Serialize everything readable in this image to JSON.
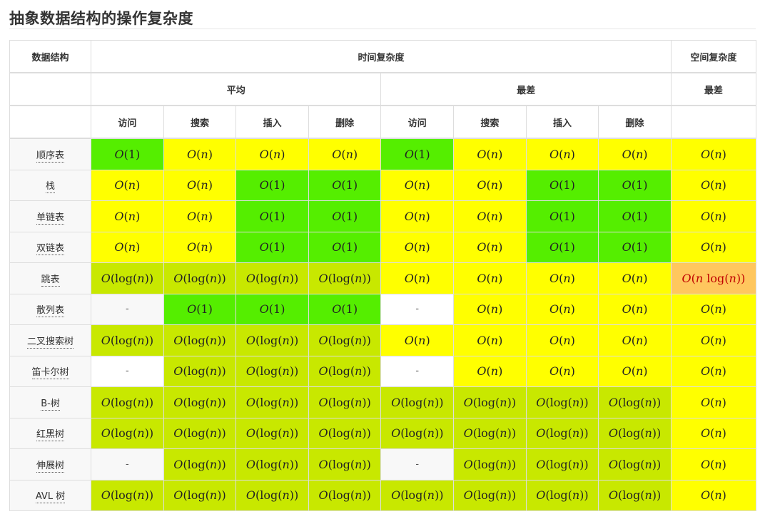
{
  "title": "抽象数据结构的操作复杂度",
  "header": {
    "structure": "数据结构",
    "time": "时间复杂度",
    "space": "空间复杂度",
    "average": "平均",
    "worst": "最差",
    "space_worst": "最差",
    "ops": [
      "访问",
      "搜索",
      "插入",
      "删除",
      "访问",
      "搜索",
      "插入",
      "删除"
    ]
  },
  "colors": {
    "g": "#55ee00",
    "y": "#ffff00",
    "l": "#c8e800",
    "o": "#ffc75e",
    "w": "#ffffff",
    "n": "#f8f8f8"
  },
  "rows": [
    {
      "name": "顺序表",
      "cells": [
        [
          "O(1)",
          "g"
        ],
        [
          "O(n)",
          "y"
        ],
        [
          "O(n)",
          "y"
        ],
        [
          "O(n)",
          "y"
        ],
        [
          "O(1)",
          "g"
        ],
        [
          "O(n)",
          "y"
        ],
        [
          "O(n)",
          "y"
        ],
        [
          "O(n)",
          "y"
        ],
        [
          "O(n)",
          "y"
        ]
      ]
    },
    {
      "name": "栈",
      "cells": [
        [
          "O(n)",
          "y"
        ],
        [
          "O(n)",
          "y"
        ],
        [
          "O(1)",
          "g"
        ],
        [
          "O(1)",
          "g"
        ],
        [
          "O(n)",
          "y"
        ],
        [
          "O(n)",
          "y"
        ],
        [
          "O(1)",
          "g"
        ],
        [
          "O(1)",
          "g"
        ],
        [
          "O(n)",
          "y"
        ]
      ]
    },
    {
      "name": "单链表",
      "cells": [
        [
          "O(n)",
          "y"
        ],
        [
          "O(n)",
          "y"
        ],
        [
          "O(1)",
          "g"
        ],
        [
          "O(1)",
          "g"
        ],
        [
          "O(n)",
          "y"
        ],
        [
          "O(n)",
          "y"
        ],
        [
          "O(1)",
          "g"
        ],
        [
          "O(1)",
          "g"
        ],
        [
          "O(n)",
          "y"
        ]
      ]
    },
    {
      "name": "双链表",
      "cells": [
        [
          "O(n)",
          "y"
        ],
        [
          "O(n)",
          "y"
        ],
        [
          "O(1)",
          "g"
        ],
        [
          "O(1)",
          "g"
        ],
        [
          "O(n)",
          "y"
        ],
        [
          "O(n)",
          "y"
        ],
        [
          "O(1)",
          "g"
        ],
        [
          "O(1)",
          "g"
        ],
        [
          "O(n)",
          "y"
        ]
      ]
    },
    {
      "name": "跳表",
      "cells": [
        [
          "O(log(n))",
          "l"
        ],
        [
          "O(log(n))",
          "l"
        ],
        [
          "O(log(n))",
          "l"
        ],
        [
          "O(log(n))",
          "l"
        ],
        [
          "O(n)",
          "y"
        ],
        [
          "O(n)",
          "y"
        ],
        [
          "O(n)",
          "y"
        ],
        [
          "O(n)",
          "y"
        ],
        [
          "O(n log(n))",
          "o"
        ]
      ]
    },
    {
      "name": "散列表",
      "cells": [
        [
          "-",
          "n"
        ],
        [
          "O(1)",
          "g"
        ],
        [
          "O(1)",
          "g"
        ],
        [
          "O(1)",
          "g"
        ],
        [
          "-",
          "w"
        ],
        [
          "O(n)",
          "y"
        ],
        [
          "O(n)",
          "y"
        ],
        [
          "O(n)",
          "y"
        ],
        [
          "O(n)",
          "y"
        ]
      ]
    },
    {
      "name": "二叉搜索树",
      "cells": [
        [
          "O(log(n))",
          "l"
        ],
        [
          "O(log(n))",
          "l"
        ],
        [
          "O(log(n))",
          "l"
        ],
        [
          "O(log(n))",
          "l"
        ],
        [
          "O(n)",
          "y"
        ],
        [
          "O(n)",
          "y"
        ],
        [
          "O(n)",
          "y"
        ],
        [
          "O(n)",
          "y"
        ],
        [
          "O(n)",
          "y"
        ]
      ]
    },
    {
      "name": "笛卡尔树",
      "cells": [
        [
          "-",
          "w"
        ],
        [
          "O(log(n))",
          "l"
        ],
        [
          "O(log(n))",
          "l"
        ],
        [
          "O(log(n))",
          "l"
        ],
        [
          "-",
          "w"
        ],
        [
          "O(n)",
          "y"
        ],
        [
          "O(n)",
          "y"
        ],
        [
          "O(n)",
          "y"
        ],
        [
          "O(n)",
          "y"
        ]
      ]
    },
    {
      "name": "B-树",
      "cells": [
        [
          "O(log(n))",
          "l"
        ],
        [
          "O(log(n))",
          "l"
        ],
        [
          "O(log(n))",
          "l"
        ],
        [
          "O(log(n))",
          "l"
        ],
        [
          "O(log(n))",
          "l"
        ],
        [
          "O(log(n))",
          "l"
        ],
        [
          "O(log(n))",
          "l"
        ],
        [
          "O(log(n))",
          "l"
        ],
        [
          "O(n)",
          "y"
        ]
      ]
    },
    {
      "name": "红黑树",
      "cells": [
        [
          "O(log(n))",
          "l"
        ],
        [
          "O(log(n))",
          "l"
        ],
        [
          "O(log(n))",
          "l"
        ],
        [
          "O(log(n))",
          "l"
        ],
        [
          "O(log(n))",
          "l"
        ],
        [
          "O(log(n))",
          "l"
        ],
        [
          "O(log(n))",
          "l"
        ],
        [
          "O(log(n))",
          "l"
        ],
        [
          "O(n)",
          "y"
        ]
      ]
    },
    {
      "name": "伸展树",
      "cells": [
        [
          "-",
          "n"
        ],
        [
          "O(log(n))",
          "l"
        ],
        [
          "O(log(n))",
          "l"
        ],
        [
          "O(log(n))",
          "l"
        ],
        [
          "-",
          "n"
        ],
        [
          "O(log(n))",
          "l"
        ],
        [
          "O(log(n))",
          "l"
        ],
        [
          "O(log(n))",
          "l"
        ],
        [
          "O(n)",
          "y"
        ]
      ]
    },
    {
      "name": "AVL 树",
      "cells": [
        [
          "O(log(n))",
          "l"
        ],
        [
          "O(log(n))",
          "l"
        ],
        [
          "O(log(n))",
          "l"
        ],
        [
          "O(log(n))",
          "l"
        ],
        [
          "O(log(n))",
          "l"
        ],
        [
          "O(log(n))",
          "l"
        ],
        [
          "O(log(n))",
          "l"
        ],
        [
          "O(log(n))",
          "l"
        ],
        [
          "O(n)",
          "y"
        ]
      ]
    }
  ]
}
